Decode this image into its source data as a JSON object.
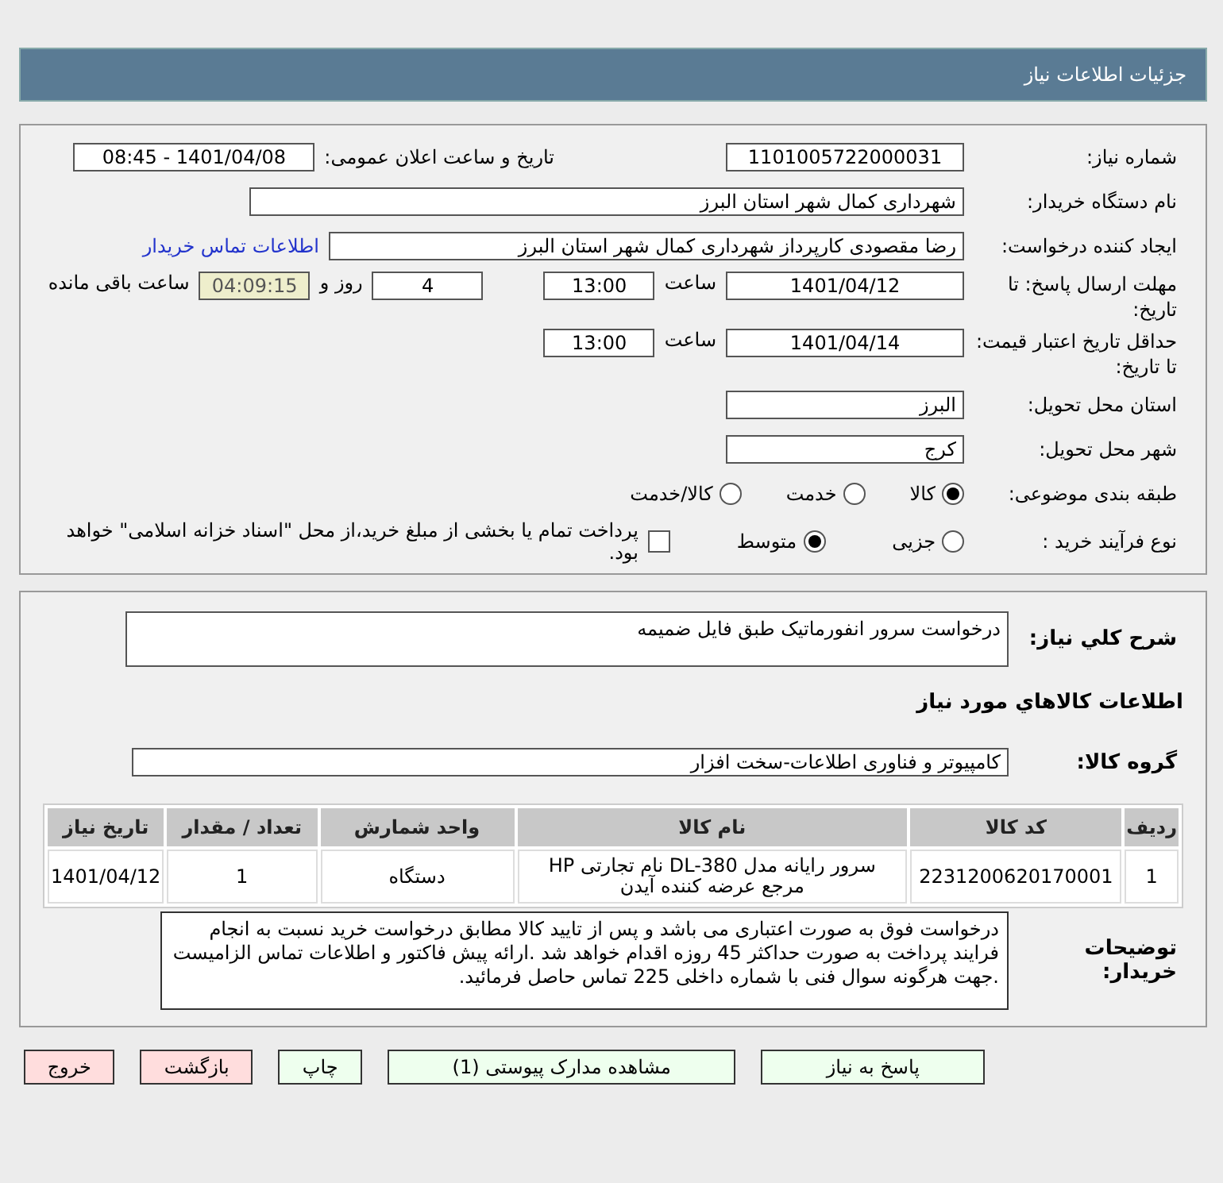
{
  "header": {
    "title": "جزئیات اطلاعات نیاز"
  },
  "need_info": {
    "need_number": {
      "label": "شماره نیاز:",
      "value": "1101005722000031"
    },
    "announce": {
      "label": "تاریخ و ساعت اعلان عمومی:",
      "value": "1401/04/08 - 08:45"
    },
    "buyer_org": {
      "label": "نام دستگاه خریدار:",
      "value": "شهرداری کمال شهر استان البرز"
    },
    "requester": {
      "label": "ایجاد کننده درخواست:",
      "value": "رضا مقصودی کارپرداز شهرداری کمال شهر استان البرز",
      "link": "اطلاعات تماس خریدار"
    },
    "reply_deadline": {
      "label": "مهلت ارسال پاسخ: تا تاریخ:",
      "date": "1401/04/12",
      "time_label": "ساعت",
      "time": "13:00",
      "days": "4",
      "days_label": "روز و",
      "remaining": "04:09:15",
      "remaining_label": "ساعت باقی مانده"
    },
    "price_validity": {
      "label": "حداقل تاریخ اعتبار قیمت: تا تاریخ:",
      "date": "1401/04/14",
      "time_label": "ساعت",
      "time": "13:00"
    },
    "province": {
      "label": "استان محل تحویل:",
      "value": "البرز"
    },
    "city": {
      "label": "شهر محل تحویل:",
      "value": "کرج"
    },
    "category": {
      "label": "طبقه بندی موضوعی:",
      "options": [
        {
          "label": "كالا",
          "selected": true
        },
        {
          "label": "خدمت",
          "selected": false
        },
        {
          "label": "كالا/خدمت",
          "selected": false
        }
      ]
    },
    "process": {
      "label": "نوع فرآیند خرید :",
      "options": [
        {
          "label": "جزیی",
          "selected": false
        },
        {
          "label": "متوسط",
          "selected": true
        }
      ],
      "payment": {
        "checked": false,
        "text": "پرداخت تمام یا بخشی از مبلغ خرید،از محل \"اسناد خزانه اسلامی\" خواهد بود."
      }
    }
  },
  "details": {
    "description": {
      "label": "شرح كلي نياز:",
      "value": "درخواست سرور انفورماتیک طبق فایل ضمیمه"
    },
    "goods_heading": "اطلاعات كالاهاي مورد نياز",
    "group": {
      "label": "گروه کالا:",
      "value": "کامپیوتر و فناوری اطلاعات-سخت افزار"
    },
    "table": {
      "columns": [
        "ردیف",
        "کد کالا",
        "نام کالا",
        "واحد شمارش",
        "تعداد / مقدار",
        "تاریخ نیاز"
      ],
      "rows": [
        [
          "1",
          "2231200620170001",
          "سرور رایانه مدل DL-380 نام تجارتی HP مرجع عرضه کننده آیدن",
          "دستگاه",
          "1",
          "1401/04/12"
        ]
      ]
    },
    "notes": {
      "label": "توضیحات خریدار:",
      "value": "درخواست فوق به صورت اعتباری می باشد و پس از تایید کالا مطابق درخواست خرید نسبت به انجام فرایند پرداخت به صورت حداکثر 45 روزه اقدام خواهد شد .ارائه پیش فاکتور و اطلاعات تماس الزامیست .جهت هرگونه سوال فنی با شماره داخلی 225 تماس حاصل فرمائید."
    }
  },
  "buttons": [
    {
      "label": "پاسخ به نیاز",
      "kind": "action"
    },
    {
      "label": "مشاهده مدارک پیوستی (1)",
      "kind": "action"
    },
    {
      "label": "چاپ",
      "kind": "action"
    },
    {
      "label": "بازگشت",
      "kind": "danger"
    },
    {
      "label": "خروج",
      "kind": "danger"
    }
  ]
}
